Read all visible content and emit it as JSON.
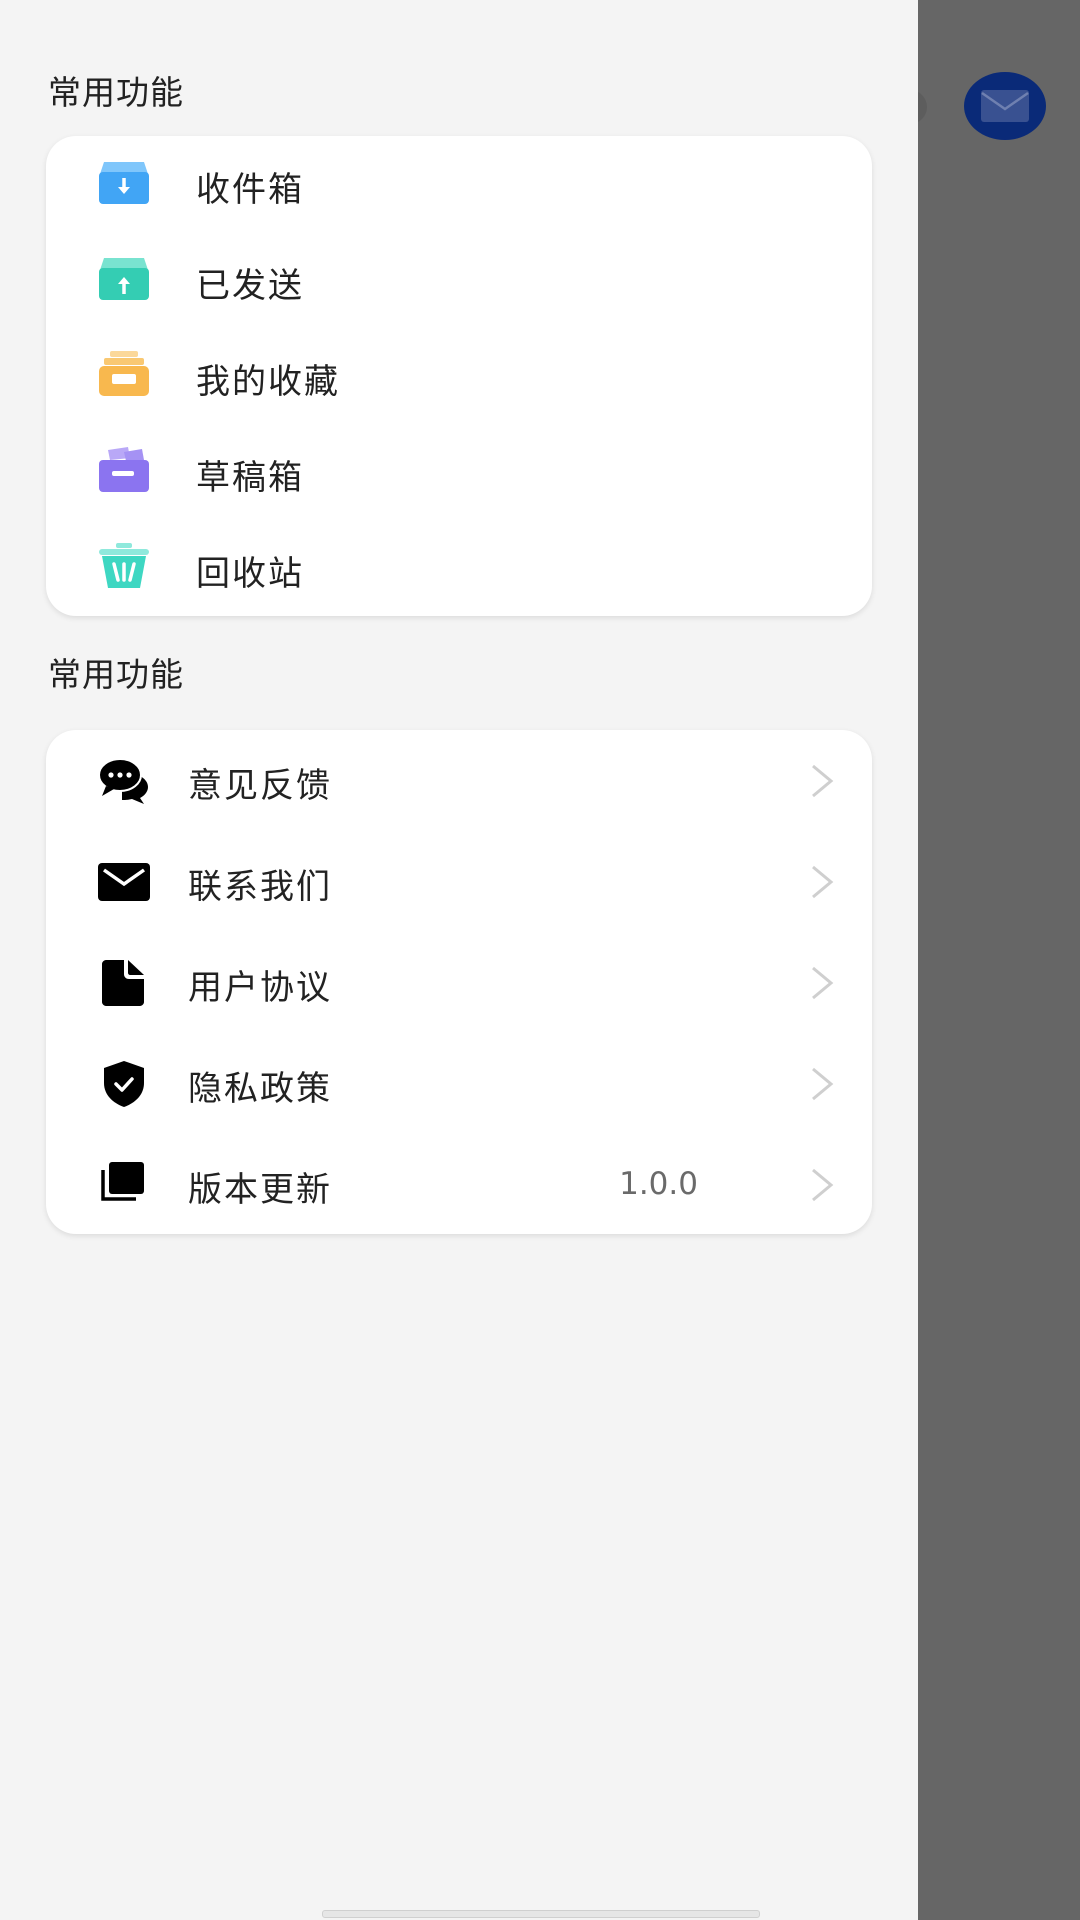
{
  "drawer": {
    "section1": {
      "title": "常用功能",
      "items": [
        {
          "label": "收件箱",
          "icon": "inbox-icon",
          "color": "#41A5F5"
        },
        {
          "label": "已发送",
          "icon": "sent-icon",
          "color": "#34CDB3"
        },
        {
          "label": "我的收藏",
          "icon": "favorites-icon",
          "color": "#F8B84E"
        },
        {
          "label": "草稿箱",
          "icon": "drafts-icon",
          "color": "#8B74F0"
        },
        {
          "label": "回收站",
          "icon": "trash-icon",
          "color": "#3ED7C2"
        }
      ]
    },
    "section2": {
      "title": "常用功能",
      "items": [
        {
          "label": "意见反馈",
          "icon": "chat-bubbles-icon",
          "value": ""
        },
        {
          "label": "联系我们",
          "icon": "mail-icon",
          "value": ""
        },
        {
          "label": "用户协议",
          "icon": "document-icon",
          "value": ""
        },
        {
          "label": "隐私政策",
          "icon": "shield-check-icon",
          "value": ""
        },
        {
          "label": "版本更新",
          "icon": "stacked-pages-icon",
          "value": "1.0.0"
        }
      ]
    }
  },
  "background": {
    "fab_icon": "mail-icon",
    "fab_color": "#0A2A78"
  }
}
